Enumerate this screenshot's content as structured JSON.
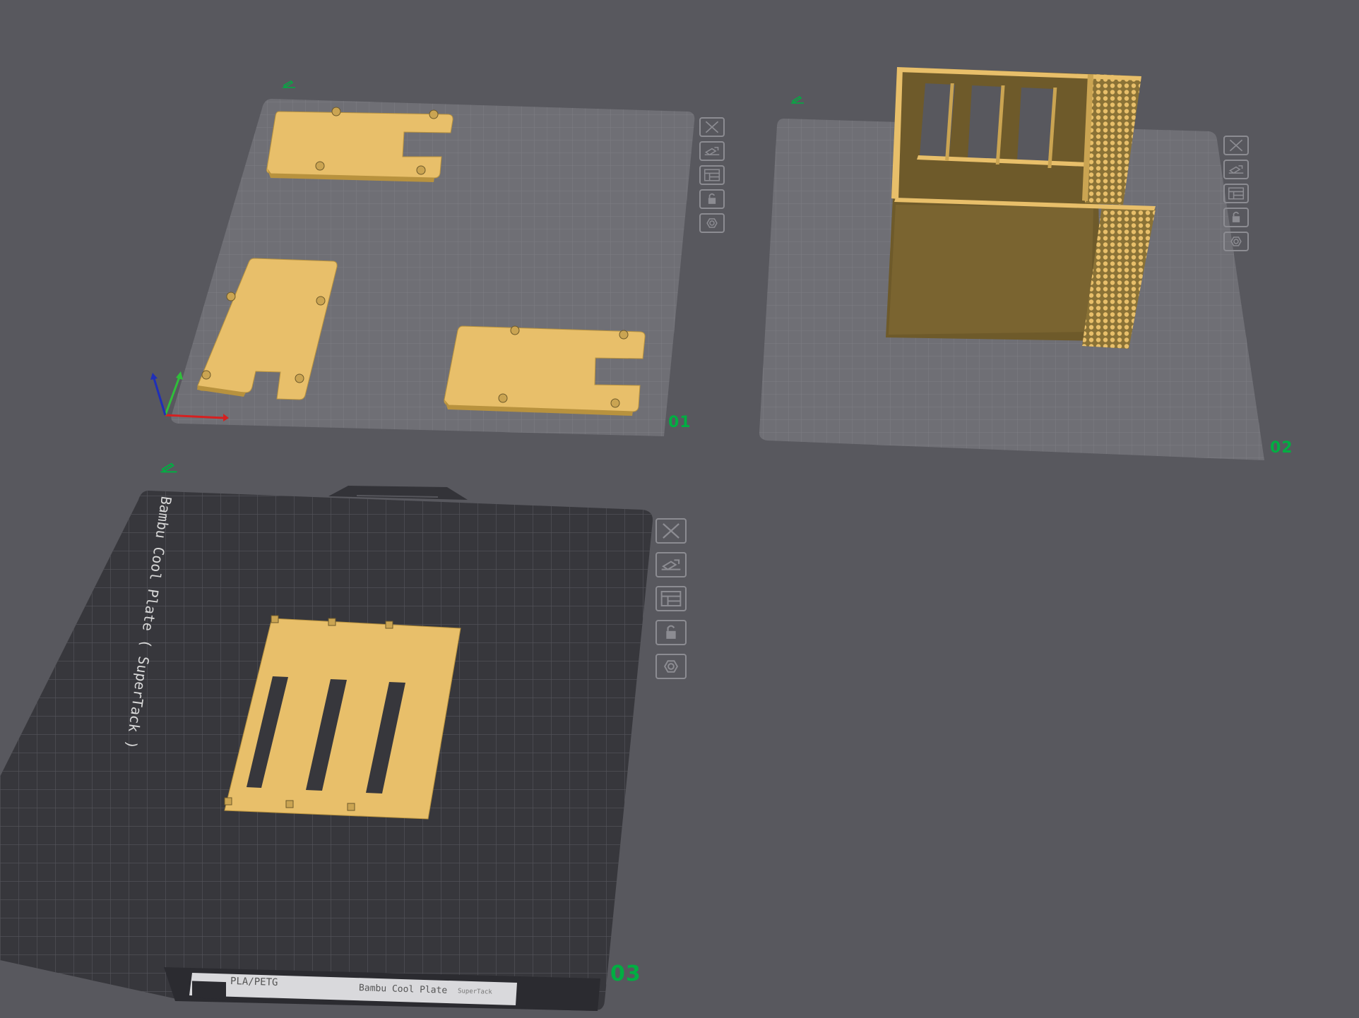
{
  "app": {
    "viewport": "3D plate view"
  },
  "plates": [
    {
      "number": "01",
      "buttons": [
        "close-icon",
        "auto-orient-icon",
        "arrange-icon",
        "lock-icon",
        "settings-icon"
      ]
    },
    {
      "number": "02",
      "buttons": [
        "close-icon",
        "auto-orient-icon",
        "arrange-icon",
        "lock-icon",
        "settings-icon"
      ]
    },
    {
      "number": "03",
      "buttons": [
        "close-icon",
        "auto-orient-icon",
        "arrange-icon",
        "lock-icon",
        "settings-icon"
      ],
      "build_plate": {
        "side_label": "Bambu Cool Plate ( SuperTack )",
        "sticker_left": "PLA/PETG",
        "sticker_right": "Bambu Cool Plate",
        "sticker_right_small": "SuperTack"
      }
    }
  ],
  "colors": {
    "background": "#58585e",
    "plate_grid": "#6e6e74",
    "model": "#e8bf6a",
    "model_dark": "#6e5a2a",
    "accent": "#00ae42",
    "axis_x": "#d62020",
    "axis_y": "#2fbf3a",
    "axis_z": "#1f2fb8"
  }
}
